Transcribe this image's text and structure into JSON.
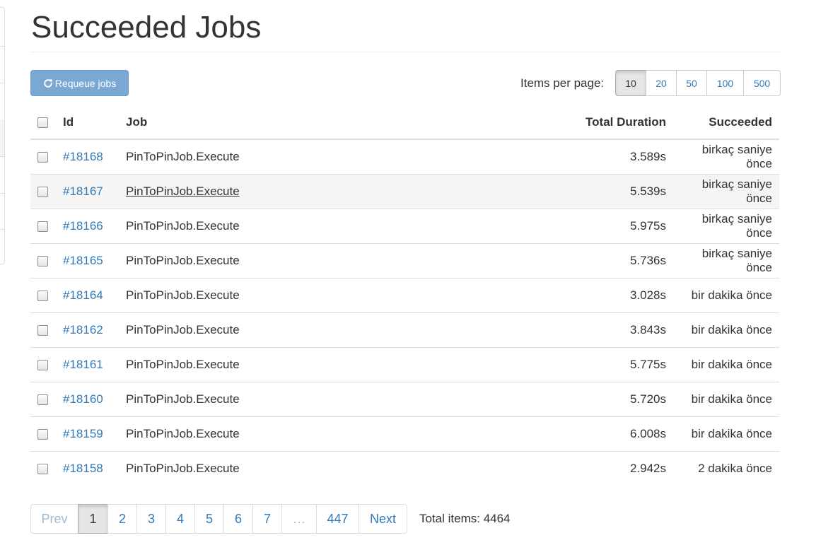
{
  "page": {
    "title": "Succeeded Jobs"
  },
  "toolbar": {
    "requeue_label": "Requeue jobs",
    "items_per_page_label": "Items per page:"
  },
  "items_per_page": {
    "options": [
      "10",
      "20",
      "50",
      "100",
      "500"
    ],
    "selected": "10"
  },
  "table": {
    "headers": {
      "id": "Id",
      "job": "Job",
      "duration": "Total Duration",
      "succeeded": "Succeeded"
    },
    "rows": [
      {
        "id": "#18168",
        "job": "PinToPinJob.Execute",
        "duration": "3.589s",
        "succeeded": "birkaç saniye önce"
      },
      {
        "id": "#18167",
        "job": "PinToPinJob.Execute",
        "duration": "5.539s",
        "succeeded": "birkaç saniye önce"
      },
      {
        "id": "#18166",
        "job": "PinToPinJob.Execute",
        "duration": "5.975s",
        "succeeded": "birkaç saniye önce"
      },
      {
        "id": "#18165",
        "job": "PinToPinJob.Execute",
        "duration": "5.736s",
        "succeeded": "birkaç saniye önce"
      },
      {
        "id": "#18164",
        "job": "PinToPinJob.Execute",
        "duration": "3.028s",
        "succeeded": "bir dakika önce"
      },
      {
        "id": "#18162",
        "job": "PinToPinJob.Execute",
        "duration": "3.843s",
        "succeeded": "bir dakika önce"
      },
      {
        "id": "#18161",
        "job": "PinToPinJob.Execute",
        "duration": "5.775s",
        "succeeded": "bir dakika önce"
      },
      {
        "id": "#18160",
        "job": "PinToPinJob.Execute",
        "duration": "5.720s",
        "succeeded": "bir dakika önce"
      },
      {
        "id": "#18159",
        "job": "PinToPinJob.Execute",
        "duration": "6.008s",
        "succeeded": "bir dakika önce"
      },
      {
        "id": "#18158",
        "job": "PinToPinJob.Execute",
        "duration": "2.942s",
        "succeeded": "2 dakika önce"
      }
    ]
  },
  "pagination": {
    "prev": "Prev",
    "pages": [
      "1",
      "2",
      "3",
      "4",
      "5",
      "6",
      "7",
      "…",
      "447"
    ],
    "current": "1",
    "next": "Next",
    "total_label": "Total items: 4464"
  },
  "icons": {
    "requeue": "refresh-icon"
  },
  "colors": {
    "link": "#337ab7",
    "button": "#7aa8d3"
  }
}
